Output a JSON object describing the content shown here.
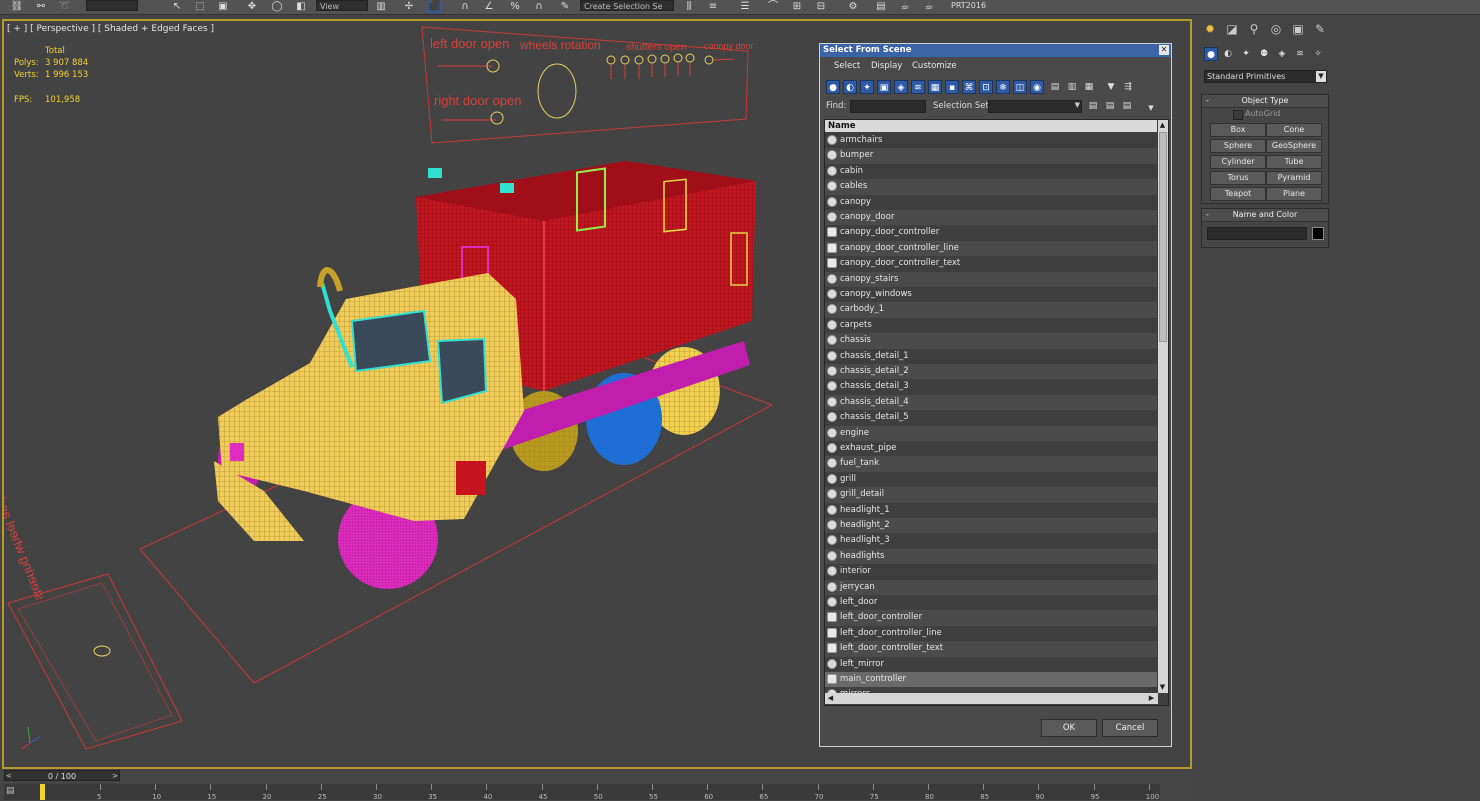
{
  "toolbar": {
    "view_dropdown": "View",
    "selection_set_dropdown": "Create Selection Se",
    "project_label": "PRT2016"
  },
  "viewport": {
    "label": "[ + ] [ Perspective ] [ Shaded + Edged Faces ]",
    "stats": {
      "header": "Total",
      "polys_label": "Polys:",
      "polys_value": "3 907 884",
      "verts_label": "Verts:",
      "verts_value": "1 996 153",
      "fps_label": "FPS:",
      "fps_value": "101,958"
    },
    "control_panel_texts": {
      "left_door": "left door open",
      "wheels": "wheels rotation",
      "shutters": "shutters open",
      "canopy": "canopy door",
      "right_door": "right door open",
      "steering": "steering wheel and wheels rotation"
    },
    "colors": {
      "cabin": "#f0cc5a",
      "canopy": "#c8141e",
      "wheels_front": "#e02cc0",
      "wheel_blue": "#1e6ed6",
      "wheel_yellow": "#f2d050",
      "cyan": "#30e0d0",
      "grid": "#d03a3a",
      "active_border": "#b59a2a"
    }
  },
  "dialog": {
    "title": "Select From Scene",
    "close_glyph": "✕",
    "menus": [
      "Select",
      "Display",
      "Customize"
    ],
    "find_label": "Find:",
    "selection_set_label": "Selection Set:",
    "column_header": "Name",
    "items": [
      {
        "name": "armchairs",
        "type": "geometry"
      },
      {
        "name": "bumper",
        "type": "geometry"
      },
      {
        "name": "cabin",
        "type": "geometry"
      },
      {
        "name": "cables",
        "type": "geometry"
      },
      {
        "name": "canopy",
        "type": "geometry"
      },
      {
        "name": "canopy_door",
        "type": "geometry"
      },
      {
        "name": "canopy_door_controller",
        "type": "helper"
      },
      {
        "name": "canopy_door_controller_line",
        "type": "helper"
      },
      {
        "name": "canopy_door_controller_text",
        "type": "helper"
      },
      {
        "name": "canopy_stairs",
        "type": "geometry"
      },
      {
        "name": "canopy_windows",
        "type": "geometry"
      },
      {
        "name": "carbody_1",
        "type": "geometry"
      },
      {
        "name": "carpets",
        "type": "geometry"
      },
      {
        "name": "chassis",
        "type": "geometry"
      },
      {
        "name": "chassis_detail_1",
        "type": "geometry"
      },
      {
        "name": "chassis_detail_2",
        "type": "geometry"
      },
      {
        "name": "chassis_detail_3",
        "type": "geometry"
      },
      {
        "name": "chassis_detail_4",
        "type": "geometry"
      },
      {
        "name": "chassis_detail_5",
        "type": "geometry"
      },
      {
        "name": "engine",
        "type": "geometry"
      },
      {
        "name": "exhaust_pipe",
        "type": "geometry"
      },
      {
        "name": "fuel_tank",
        "type": "geometry"
      },
      {
        "name": "grill",
        "type": "geometry"
      },
      {
        "name": "grill_detail",
        "type": "geometry"
      },
      {
        "name": "headlight_1",
        "type": "geometry"
      },
      {
        "name": "headlight_2",
        "type": "geometry"
      },
      {
        "name": "headlight_3",
        "type": "geometry"
      },
      {
        "name": "headlights",
        "type": "geometry"
      },
      {
        "name": "interior",
        "type": "geometry"
      },
      {
        "name": "jerrycan",
        "type": "geometry"
      },
      {
        "name": "left_door",
        "type": "geometry"
      },
      {
        "name": "left_door_controller",
        "type": "helper"
      },
      {
        "name": "left_door_controller_line",
        "type": "helper"
      },
      {
        "name": "left_door_controller_text",
        "type": "helper"
      },
      {
        "name": "left_mirror",
        "type": "geometry"
      },
      {
        "name": "main_controller",
        "type": "helper",
        "selected": true
      },
      {
        "name": "mirrors",
        "type": "geometry"
      }
    ],
    "ok_label": "OK",
    "cancel_label": "Cancel"
  },
  "command_panel": {
    "category_dropdown": "Standard Primitives",
    "object_type_title": "Object Type",
    "autogrid_label": "AutoGrid",
    "buttons": [
      "Box",
      "Cone",
      "Sphere",
      "GeoSphere",
      "Cylinder",
      "Tube",
      "Torus",
      "Pyramid",
      "Teapot",
      "Plane"
    ],
    "name_color_title": "Name and Color",
    "swatch_color": "#000000"
  },
  "timeline": {
    "slider_label": "0 / 100",
    "ticks": [
      "5",
      "10",
      "15",
      "20",
      "25",
      "30",
      "35",
      "40",
      "45",
      "50",
      "55",
      "60",
      "65",
      "70",
      "75",
      "80",
      "85",
      "90",
      "95",
      "100"
    ]
  }
}
